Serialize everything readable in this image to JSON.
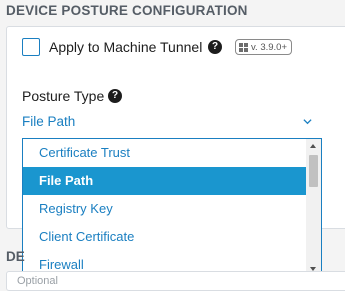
{
  "section": {
    "title": "DEVICE POSTURE CONFIGURATION"
  },
  "apply_tunnel": {
    "label": "Apply to Machine Tunnel",
    "checked": false
  },
  "version_badge": {
    "text": "v. 3.9.0+",
    "icon": "windows-icon"
  },
  "posture_type": {
    "label": "Posture Type",
    "selected_value": "File Path",
    "options": [
      {
        "label": "Certificate Trust",
        "selected": false
      },
      {
        "label": "File Path",
        "selected": true
      },
      {
        "label": "Registry Key",
        "selected": false
      },
      {
        "label": "Client Certificate",
        "selected": false
      },
      {
        "label": "Firewall",
        "selected": false
      }
    ]
  },
  "next_section": {
    "label_partial": "DE",
    "placeholder_partial": "Optional"
  },
  "icons": {
    "help": "help-circle-icon",
    "chevron": "chevron-down-icon"
  },
  "colors": {
    "accent": "#1a7fc1",
    "selected_bg": "#1a96cf",
    "section_title": "#555d66",
    "background": "#f4f4f4"
  }
}
